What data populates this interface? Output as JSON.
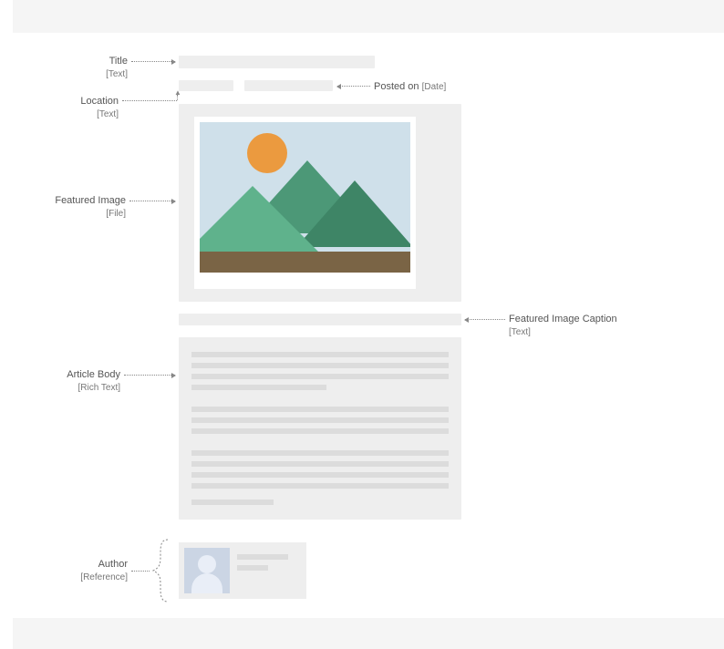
{
  "labels": {
    "title": {
      "name": "Title",
      "type": "[Text]"
    },
    "location": {
      "name": "Location",
      "type": "[Text]"
    },
    "postedOn": {
      "name": "Posted on",
      "type": "[Date]"
    },
    "featuredImage": {
      "name": "Featured Image",
      "type": "[File]"
    },
    "featuredImageCaption": {
      "name": "Featured Image Caption",
      "type": "[Text]"
    },
    "articleBody": {
      "name": "Article Body",
      "type": "[Rich Text]"
    },
    "author": {
      "name": "Author",
      "type": "[Reference]"
    }
  }
}
